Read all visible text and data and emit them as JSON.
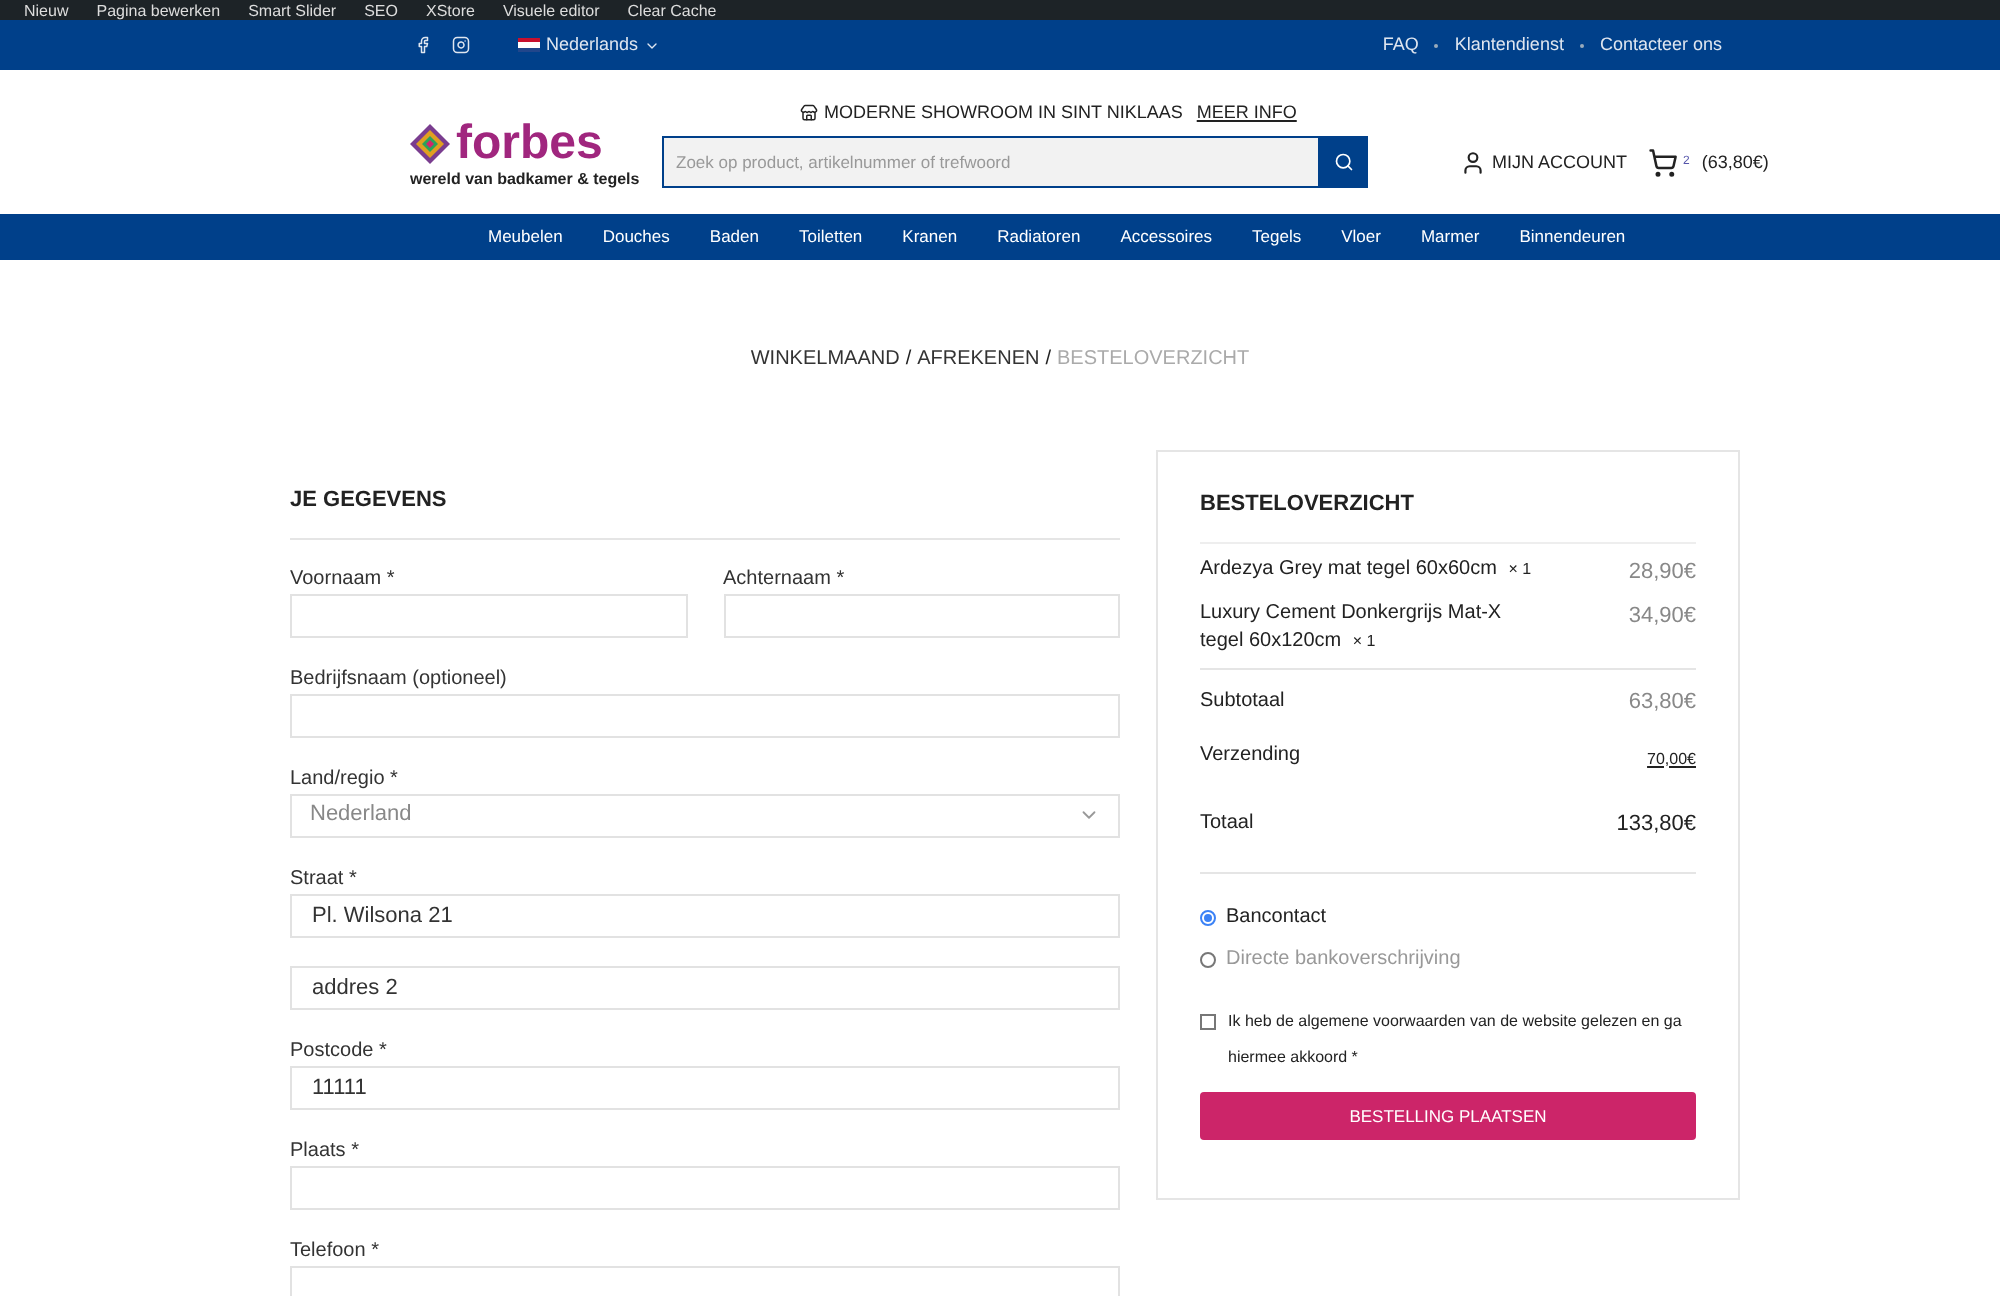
{
  "admin_bar": {
    "items": [
      "Nieuw",
      "Pagina bewerken",
      "Smart Slider",
      "SEO",
      "XStore",
      "Visuele editor",
      "Clear Cache"
    ]
  },
  "top_bar": {
    "language": "Nederlands",
    "links": [
      "FAQ",
      "Klantendienst",
      "Contacteer ons"
    ]
  },
  "header": {
    "logo": {
      "name": "forbes",
      "tagline": "wereld van badkamer & tegels"
    },
    "showroom": "MODERNE SHOWROOM IN SINT NIKLAAS",
    "showroom_link": "MEER INFO",
    "search": {
      "placeholder": "Zoek op product, artikelnummer of trefwoord"
    },
    "account": "MIJN ACCOUNT",
    "cart_count": "2",
    "cart_total": "(63,80€)"
  },
  "nav": [
    "Meubelen",
    "Douches",
    "Baden",
    "Toiletten",
    "Kranen",
    "Radiatoren",
    "Accessoires",
    "Tegels",
    "Vloer",
    "Marmer",
    "Binnendeuren"
  ],
  "breadcrumb_separator": "/",
  "breadcrumb": [
    {
      "label": "WINKELMAAND",
      "selected": false
    },
    {
      "label": "AFREKENEN",
      "selected": false
    },
    {
      "label": "BESTELOVERZICHT",
      "selected": true
    }
  ],
  "details": {
    "title": "JE GEGEVENS",
    "rows": [
      {
        "fields": [
          {
            "kind": "text",
            "label": "Voornaam *"
          },
          {
            "kind": "text",
            "label": "Achternaam *"
          }
        ]
      },
      {
        "fields": [
          {
            "kind": "text",
            "label": "Bedrijfsnaam (optioneel)"
          }
        ]
      },
      {
        "fields": [
          {
            "kind": "select",
            "label": "Land/regio *",
            "value": "Nederland"
          }
        ]
      },
      {
        "fields": [
          {
            "kind": "text",
            "label": "Straat *",
            "value": "Pl. Wilsona 21"
          }
        ]
      },
      {
        "fields": [
          {
            "kind": "text",
            "value": "addres 2"
          }
        ]
      },
      {
        "fields": [
          {
            "kind": "text",
            "label": "Postcode *",
            "value": "11111"
          }
        ]
      },
      {
        "fields": [
          {
            "kind": "text",
            "label": "Plaats *"
          }
        ]
      },
      {
        "fields": [
          {
            "kind": "text",
            "label": "Telefoon *"
          }
        ]
      }
    ]
  },
  "summary": {
    "title": "BESTELOVERZICHT",
    "items": [
      {
        "name": "Ardezya Grey mat tegel 60x60cm",
        "qty": "× 1",
        "price": "28,90€"
      },
      {
        "name": "Luxury Cement Donkergrijs Mat-X tegel 60x120cm",
        "qty": "× 1",
        "price": "34,90€"
      }
    ],
    "subtotal_label": "Subtotaal",
    "subtotal": "63,80€",
    "shipping_label": "Verzending",
    "shipping": "70,00€",
    "total_label": "Totaal",
    "total": "133,80€",
    "payment": [
      {
        "label": "Bancontact",
        "selected": true
      },
      {
        "label": "Directe bankoverschrijving",
        "selected": false
      }
    ],
    "terms": {
      "label": "Ik heb de algemene voorwaarden van de website gelezen en ga hiermee akkoord *",
      "checked": false
    },
    "button": "BESTELLING PLAATSEN"
  }
}
